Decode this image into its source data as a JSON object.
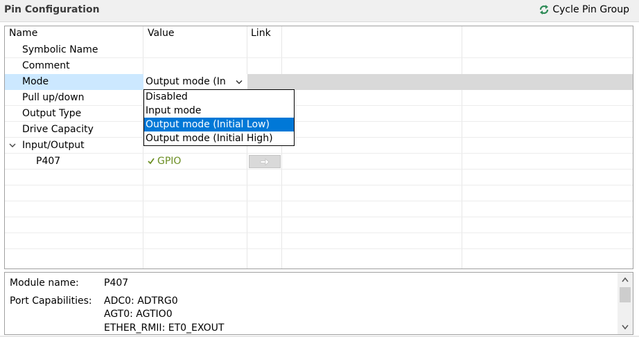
{
  "header": {
    "title": "Pin Configuration",
    "cycle_label": "Cycle Pin Group"
  },
  "table": {
    "columns": [
      "Name",
      "Value",
      "Link"
    ],
    "rows": [
      {
        "name": "Symbolic Name",
        "value": ""
      },
      {
        "name": "Comment",
        "value": ""
      },
      {
        "name": "Mode",
        "value": "Output mode (In"
      },
      {
        "name": "Pull up/down",
        "value": ""
      },
      {
        "name": "Output Type",
        "value": ""
      },
      {
        "name": "Drive Capacity",
        "value": ""
      },
      {
        "name": "Input/Output",
        "value": ""
      },
      {
        "name": "P407",
        "value": "GPIO"
      }
    ]
  },
  "dropdown": {
    "options": [
      "Disabled",
      "Input mode",
      "Output mode (Initial Low)",
      "Output mode (Initial High)"
    ],
    "selected_index": 2
  },
  "info": {
    "module_label": "Module name:",
    "module_value": "P407",
    "capabilities_label": "Port Capabilities:",
    "capabilities": [
      "ADC0: ADTRG0",
      "AGT0: AGTIO0",
      "ETHER_RMII: ET0_EXOUT"
    ]
  },
  "colors": {
    "selection_blue": "#0078d7",
    "selected_row": "#d9d9d9",
    "selected_name_cell": "#cce8ff",
    "gpio_green": "#6b8e23"
  },
  "icons": {
    "cycle": "cycle-arrows-icon",
    "check": "check-icon",
    "link": "arrow-right-icon",
    "expander": "chevron-down-icon",
    "combo": "chevron-down-icon"
  }
}
